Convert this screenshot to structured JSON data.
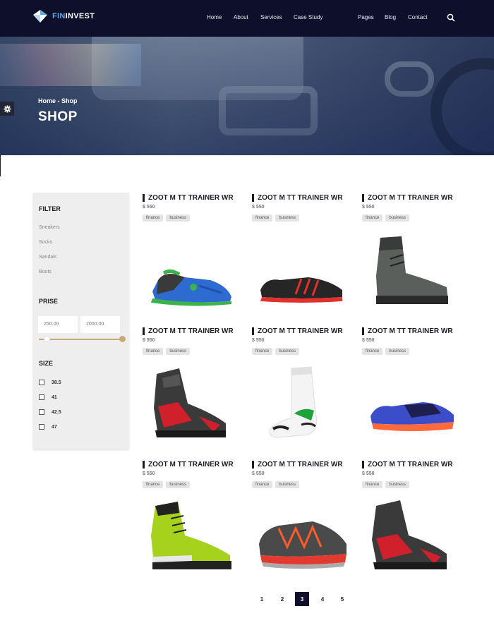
{
  "brand": {
    "name_part1": "FIN",
    "name_part2": "INVEST"
  },
  "nav": {
    "items": [
      "Home",
      "About",
      "Services",
      "Case Study",
      "Pages",
      "Blog",
      "Contact"
    ]
  },
  "hero": {
    "breadcrumb": "Home - Shop",
    "title": "SHOP"
  },
  "filter": {
    "title": "FILTER",
    "categories": [
      "Sneakers",
      "Socks",
      "Sandals",
      "Boots"
    ],
    "price_title": "PRISE",
    "price_min": "250.00",
    "price_max": "2000.00",
    "size_title": "SIZE",
    "sizes": [
      "38.5",
      "41",
      "42.5",
      "47"
    ]
  },
  "products": [
    {
      "name": "ZOOT M TT TRAINER WR",
      "price": "$ 550",
      "tags": [
        "finance",
        "business"
      ],
      "image": "blue-green-trainer"
    },
    {
      "name": "ZOOT M TT TRAINER WR",
      "price": "$ 550",
      "tags": [
        "finance",
        "business"
      ],
      "image": "black-red-runner"
    },
    {
      "name": "ZOOT M TT TRAINER WR",
      "price": "$ 550",
      "tags": [
        "finance",
        "business"
      ],
      "image": "grey-hiking-boot"
    },
    {
      "name": "ZOOT M TT TRAINER WR",
      "price": "$ 550",
      "tags": [
        "finance",
        "business"
      ],
      "image": "red-black-boot"
    },
    {
      "name": "ZOOT M TT TRAINER WR",
      "price": "$ 550",
      "tags": [
        "finance",
        "business"
      ],
      "image": "white-sport-sock"
    },
    {
      "name": "ZOOT M TT TRAINER WR",
      "price": "$ 550",
      "tags": [
        "finance",
        "business"
      ],
      "image": "blue-orange-runner"
    },
    {
      "name": "ZOOT M TT TRAINER WR",
      "price": "$ 550",
      "tags": [
        "finance",
        "business"
      ],
      "image": "lime-mountain-boot"
    },
    {
      "name": "ZOOT M TT TRAINER WR",
      "price": "$ 550",
      "tags": [
        "finance",
        "business"
      ],
      "image": "grey-orange-trail-shoe"
    },
    {
      "name": "ZOOT M TT TRAINER WR",
      "price": "$ 550",
      "tags": [
        "finance",
        "business"
      ],
      "image": "red-black-boot"
    }
  ],
  "pagination": {
    "pages": [
      "1",
      "2",
      "3",
      "4",
      "5"
    ],
    "current": "3"
  },
  "colors": {
    "header_bg": "#0d0f2b",
    "accent": "#c9a878",
    "logo_blue": "#5aa8e6"
  }
}
